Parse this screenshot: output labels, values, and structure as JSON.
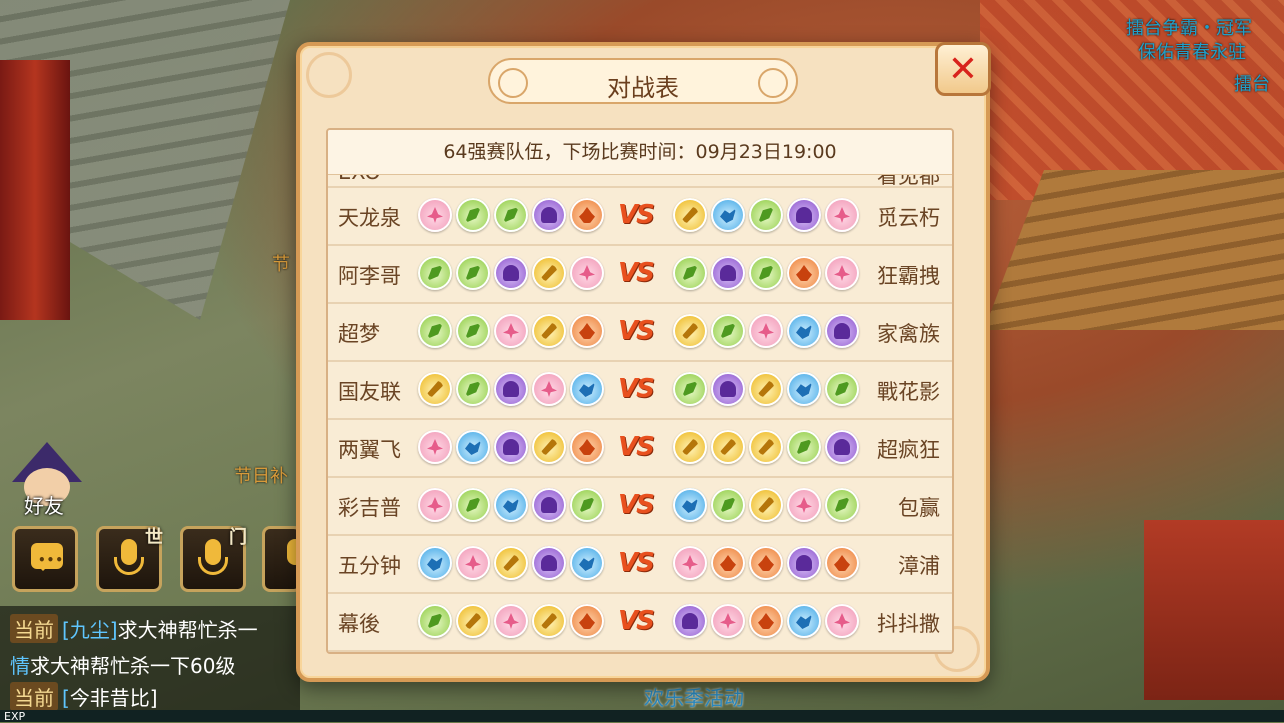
{
  "scene": {
    "top_right_1": "擂台争霸・冠军",
    "top_right_2": "保佑青春永驻",
    "top_right_3": "擂台",
    "mid_left_1": "节",
    "mid_left_2": "节日补",
    "bottom_center": "欢乐季活动"
  },
  "hud": {
    "friends_label": "好友",
    "world_tag": "世",
    "faction_tag": "门"
  },
  "chat": [
    {
      "channel": "当前",
      "name": "[九尘]",
      "text": "求大神帮忙杀一"
    },
    {
      "channel": "",
      "name": "情",
      "text": "求大神帮忙杀一下60级"
    },
    {
      "channel": "当前",
      "name": "[",
      "text": "今非昔比]"
    }
  ],
  "exp_label": "EXP",
  "panel": {
    "title": "对战表",
    "close_label": "✕",
    "subheader": "64强赛队伍，下场比赛时间：09月23日19:00",
    "vs_label": "VS",
    "partial_row": {
      "left": "EXO",
      "right": "看见都"
    },
    "matches": [
      {
        "left": "天龙泉",
        "left_icons": [
          "lotus",
          "leaf",
          "leaf",
          "ghost",
          "fire"
        ],
        "right_icons": [
          "sword",
          "water",
          "leaf",
          "ghost",
          "lotus"
        ],
        "right": "觅云朽"
      },
      {
        "left": "阿李哥",
        "left_icons": [
          "leaf",
          "leaf",
          "ghost",
          "sword",
          "lotus"
        ],
        "right_icons": [
          "leaf",
          "ghost",
          "leaf",
          "fire",
          "lotus"
        ],
        "right": "狂霸拽"
      },
      {
        "left": "超梦",
        "left_icons": [
          "leaf",
          "leaf",
          "lotus",
          "sword",
          "fire"
        ],
        "right_icons": [
          "sword",
          "leaf",
          "lotus",
          "water",
          "ghost"
        ],
        "right": "家禽族"
      },
      {
        "left": "国友联",
        "left_icons": [
          "sword",
          "leaf",
          "ghost",
          "lotus",
          "water"
        ],
        "right_icons": [
          "leaf",
          "ghost",
          "sword",
          "water",
          "leaf"
        ],
        "right": "戰花影"
      },
      {
        "left": "两翼飞",
        "left_icons": [
          "lotus",
          "water",
          "ghost",
          "sword",
          "fire"
        ],
        "right_icons": [
          "sword",
          "sword",
          "sword",
          "leaf",
          "ghost"
        ],
        "right": "超疯狂"
      },
      {
        "left": "彩吉普",
        "left_icons": [
          "lotus",
          "leaf",
          "water",
          "ghost",
          "leaf"
        ],
        "right_icons": [
          "water",
          "leaf",
          "sword",
          "lotus",
          "leaf"
        ],
        "right": "包赢"
      },
      {
        "left": "五分钟",
        "left_icons": [
          "water",
          "lotus",
          "sword",
          "ghost",
          "water"
        ],
        "right_icons": [
          "lotus",
          "fire",
          "fire",
          "ghost",
          "fire"
        ],
        "right": "漳浦"
      },
      {
        "left": "幕後",
        "left_icons": [
          "leaf",
          "sword",
          "lotus",
          "sword",
          "fire"
        ],
        "right_icons": [
          "ghost",
          "lotus",
          "fire",
          "water",
          "lotus"
        ],
        "right": "抖抖撒"
      }
    ]
  }
}
